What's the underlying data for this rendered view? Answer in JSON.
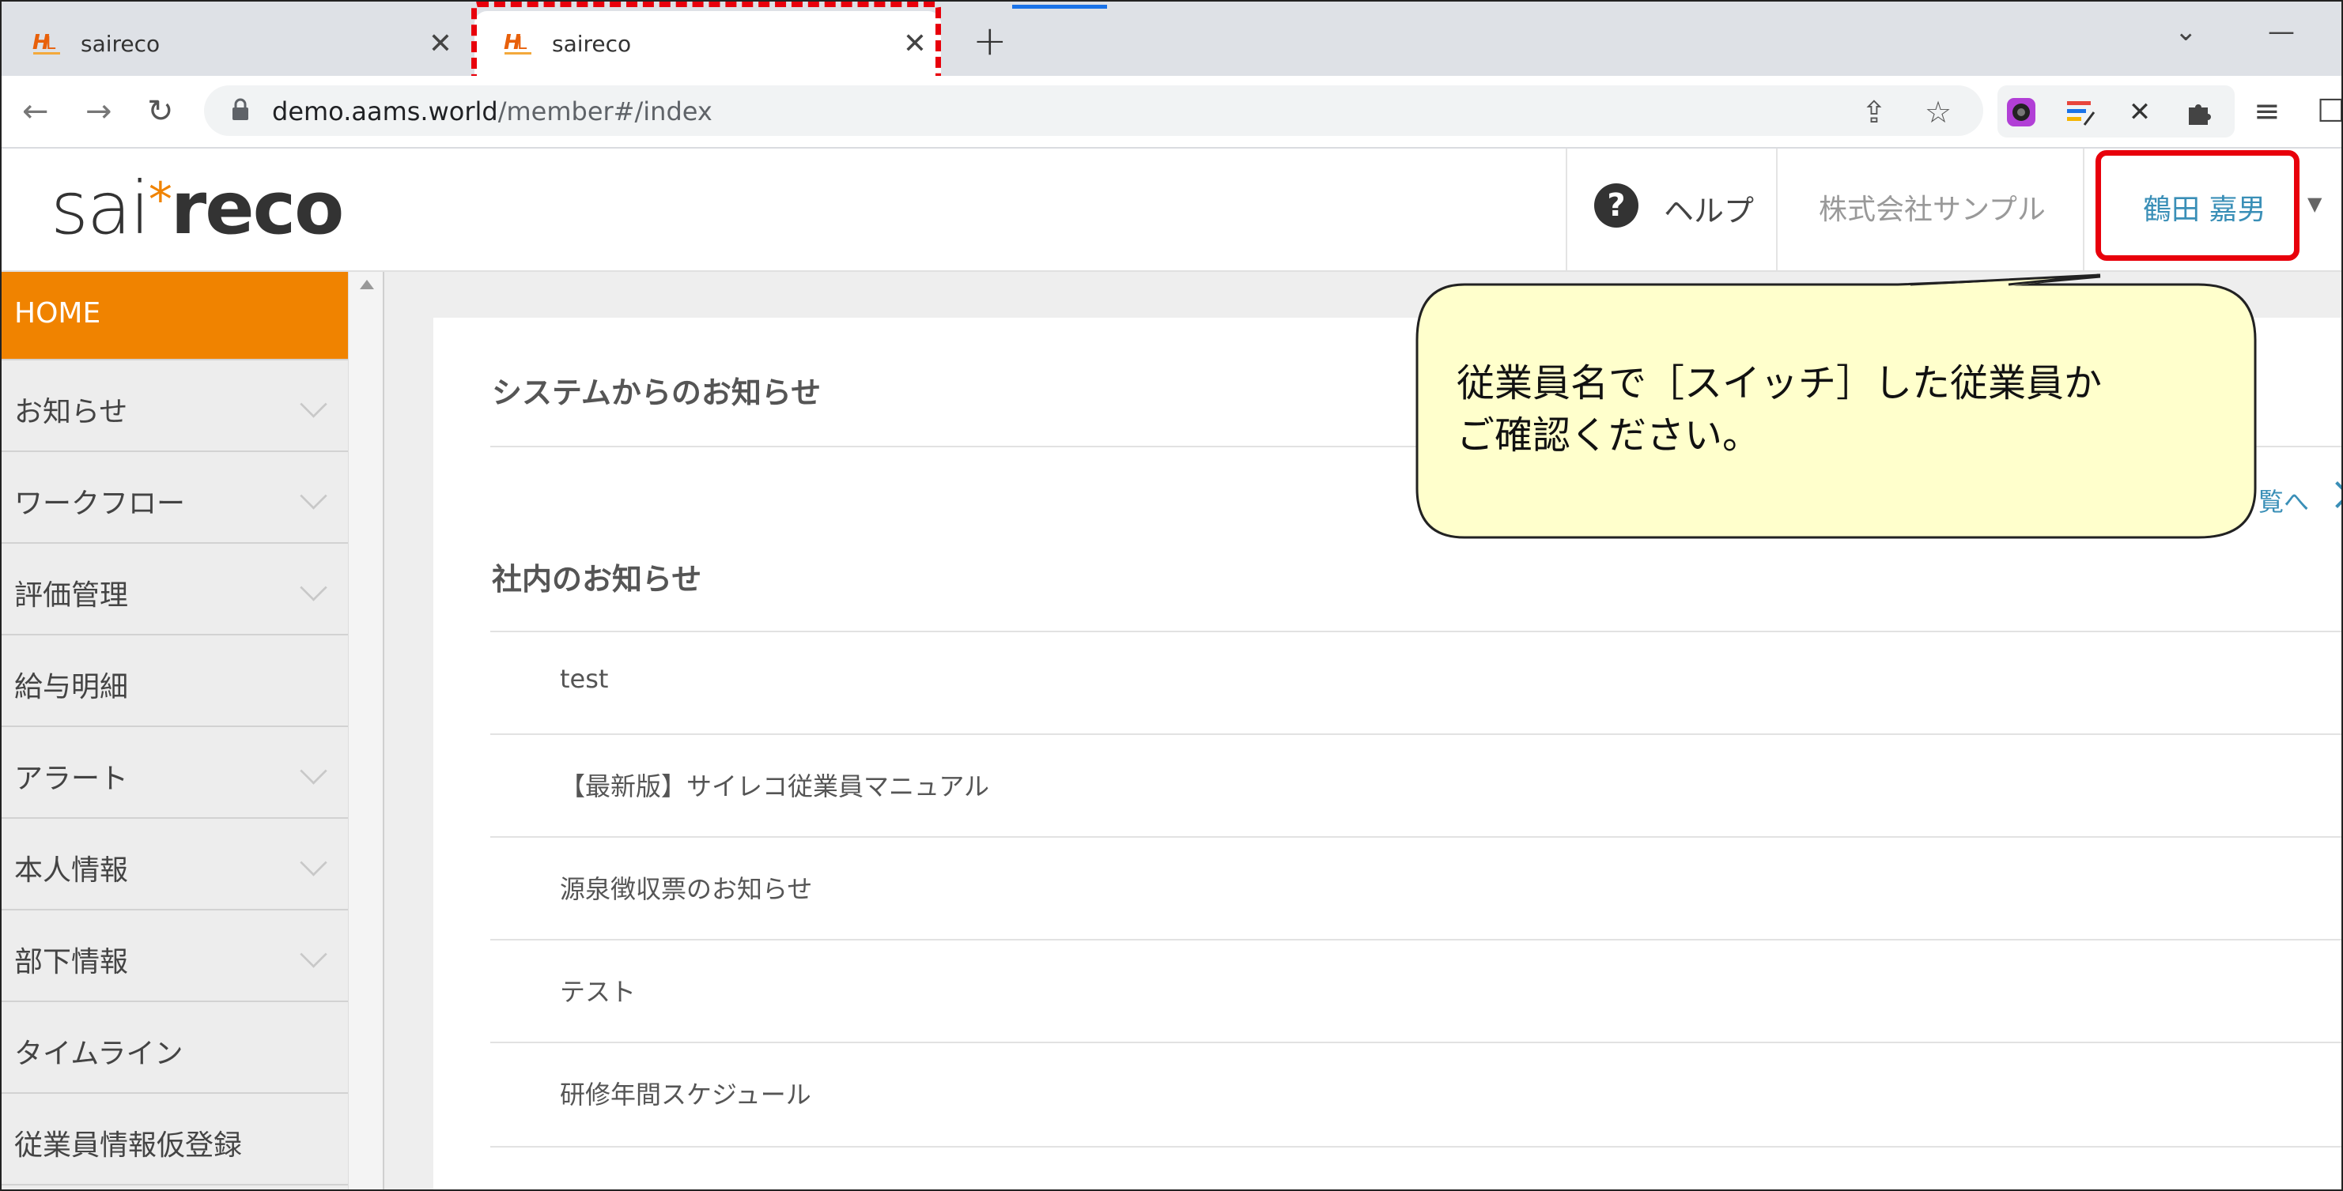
{
  "browser": {
    "tabs": [
      {
        "title": "saireco",
        "favicon": "saireco-favicon",
        "active": false
      },
      {
        "title": "saireco",
        "favicon": "saireco-favicon",
        "active": true
      }
    ],
    "new_tab_symbol": "+",
    "url_host": "demo.aams.world",
    "url_path": "/member#/index",
    "icons": [
      "back-icon",
      "forward-icon",
      "reload-icon",
      "lock-icon",
      "share-icon",
      "star-icon",
      "extension-icon",
      "media-icon"
    ]
  },
  "app": {
    "logo_sai": "sai",
    "logo_star": "*",
    "logo_reco": "reco",
    "header": {
      "help_symbol": "?",
      "help_label": "ヘルプ",
      "company": "株式会社サンプル",
      "user_name": "鶴田 嘉男"
    },
    "sidebar": {
      "items": [
        {
          "label": "HOME",
          "active": true,
          "expandable": false
        },
        {
          "label": "お知らせ",
          "expandable": true
        },
        {
          "label": "ワークフロー",
          "expandable": true
        },
        {
          "label": "評価管理",
          "expandable": true
        },
        {
          "label": "給与明細",
          "expandable": false
        },
        {
          "label": "アラート",
          "expandable": true
        },
        {
          "label": "本人情報",
          "expandable": true
        },
        {
          "label": "部下情報",
          "expandable": true
        },
        {
          "label": "タイムライン",
          "expandable": false
        },
        {
          "label": "従業員情報仮登録",
          "expandable": false
        }
      ]
    },
    "main": {
      "system_notices_title": "システムからのお知らせ",
      "more_link": "覧へ",
      "internal_notices_title": "社内のお知らせ",
      "internal_notices": [
        "test",
        "【最新版】サイレコ従業員マニュアル",
        "源泉徴収票のお知らせ",
        "テスト",
        "研修年間スケジュール"
      ]
    }
  },
  "annotation": {
    "callout_text": "従業員名で［スイッチ］した従業員か\nご確認ください。",
    "callout_fill": "#ffffcc",
    "highlight_color": "#e8000b"
  },
  "colors": {
    "accent": "#f08300",
    "link": "#3a8fb7"
  }
}
